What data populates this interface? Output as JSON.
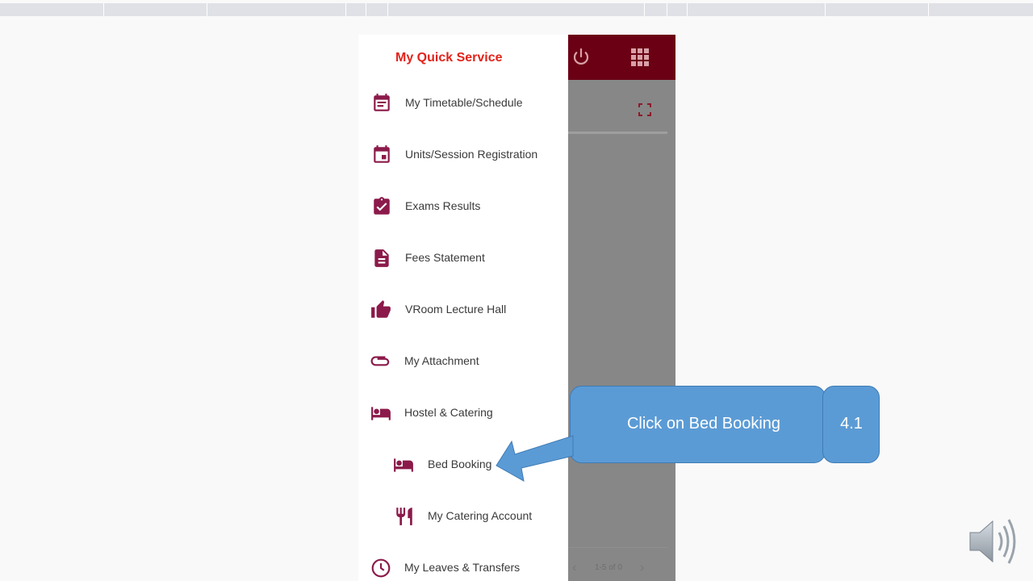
{
  "drawer": {
    "title": "My Quick Service",
    "items": [
      {
        "label": "My Timetable/Schedule",
        "icon": "calendar-note-icon"
      },
      {
        "label": "Units/Session Registration",
        "icon": "calendar-icon"
      },
      {
        "label": "Exams Results",
        "icon": "clipboard-check-icon"
      },
      {
        "label": "Fees Statement",
        "icon": "document-icon"
      },
      {
        "label": "VRoom Lecture Hall",
        "icon": "thumbs-up-icon"
      },
      {
        "label": "My Attachment",
        "icon": "paperclip-icon"
      },
      {
        "label": "Hostel & Catering",
        "icon": "bed-icon"
      },
      {
        "label": "Bed Booking",
        "icon": "bed-icon"
      },
      {
        "label": "My Catering Account",
        "icon": "fork-knife-icon"
      },
      {
        "label": "My Leaves & Transfers",
        "icon": "clock-icon"
      }
    ]
  },
  "appbar": {
    "icons": [
      "power-icon",
      "apps-grid-icon"
    ]
  },
  "content": {
    "pager_text": "1-5 of 0",
    "prev_glyph": "‹",
    "next_glyph": "›"
  },
  "callout": {
    "text": "Click on Bed Booking",
    "step": "4.1"
  },
  "colors": {
    "accent": "#e2231a",
    "appbar": "#6b0014",
    "icon": "#8b1a4a",
    "callout": "#5b9bd5"
  }
}
